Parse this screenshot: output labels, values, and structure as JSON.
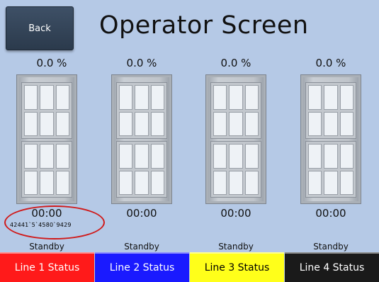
{
  "header": {
    "back_label": "Back",
    "title": "Operator Screen"
  },
  "lines": [
    {
      "percent": "0.0 %",
      "time": "00:00",
      "state": "Standby",
      "status_label": "Line 1 Status",
      "color": "#ff1a1a",
      "text_color": "#ffffff"
    },
    {
      "percent": "0.0 %",
      "time": "00:00",
      "state": "Standby",
      "status_label": "Line 2 Status",
      "color": "#1a1aff",
      "text_color": "#ffffff"
    },
    {
      "percent": "0.0 %",
      "time": "00:00",
      "state": "Standby",
      "status_label": "Line 3 Status",
      "color": "#ffff1a",
      "text_color": "#000000"
    },
    {
      "percent": "0.0 %",
      "time": "00:00",
      "state": "Standby",
      "status_label": "Line 4 Status",
      "color": "#1a1a1a",
      "text_color": "#ffffff"
    }
  ],
  "annotation": {
    "text": "42441`5`4580`9429",
    "color": "#d01a1a"
  }
}
